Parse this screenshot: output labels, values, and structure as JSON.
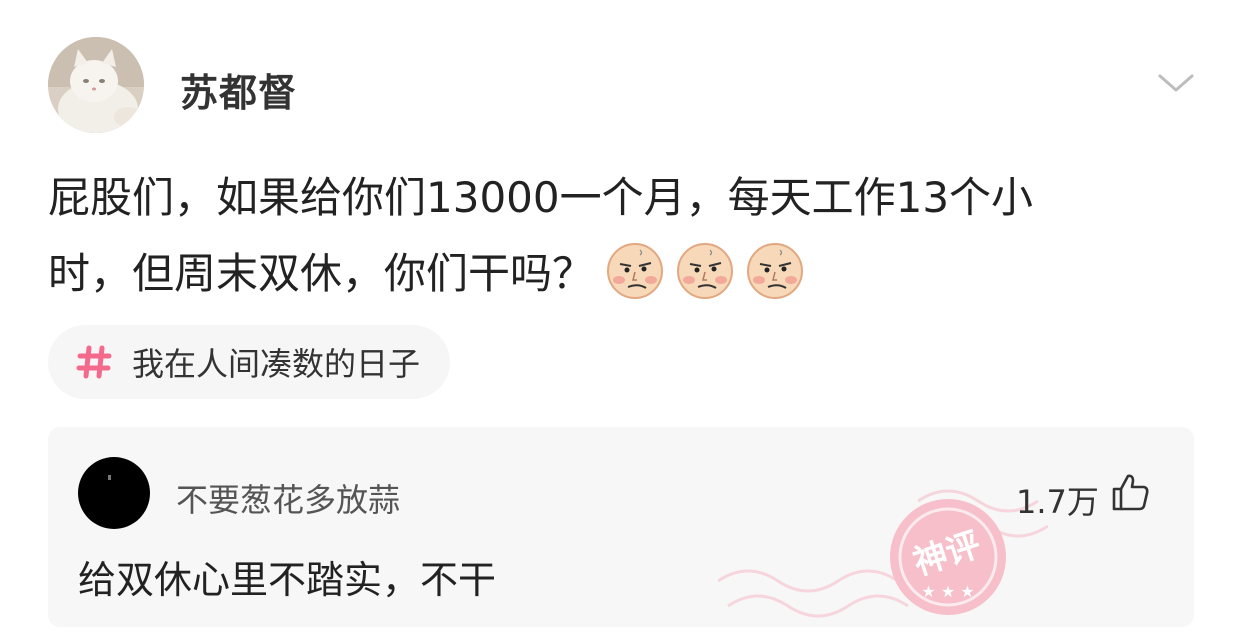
{
  "post": {
    "author": "苏都督",
    "line1": "屁股们，如果给你们13000一个月，每天工作13个小",
    "line2": "时，但周末双休，你们干吗？",
    "emoji_name": "smirk-face-emoji",
    "emoji_count": 3
  },
  "topic": {
    "label": "我在人间凑数的日子"
  },
  "comment": {
    "user": "不要葱花多放蒜",
    "text": "给双休心里不踏实，不干",
    "likes": "1.7万",
    "badge": "神评"
  },
  "colors": {
    "topic_hash": "#f46a8c",
    "stamp": "#f4a3b3",
    "card_bg": "#f7f7f7",
    "text": "#222222"
  }
}
